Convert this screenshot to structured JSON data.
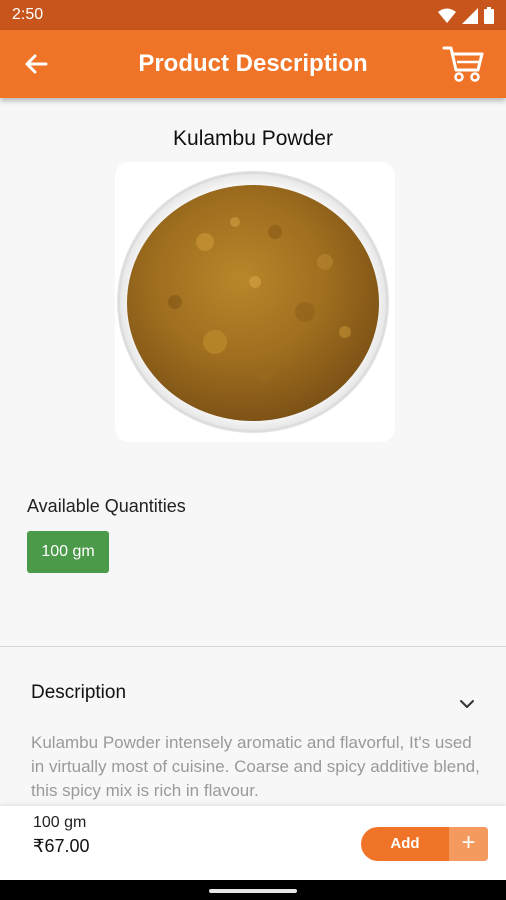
{
  "status_bar": {
    "time": "2:50"
  },
  "app_bar": {
    "title": "Product Description",
    "back_icon": "arrow-left-icon",
    "cart_icon": "shopping-cart-icon"
  },
  "product": {
    "name": "Kulambu Powder",
    "image_icon": "spice-powder-bowl-image"
  },
  "quantities": {
    "label": "Available Quantities",
    "options": [
      "100 gm"
    ],
    "selected": "100 gm"
  },
  "description": {
    "title": "Description",
    "text": "Kulambu Powder intensely aromatic and flavorful, It's used in virtually most of cuisine. Coarse and spicy additive blend, this spicy mix is rich in flavour."
  },
  "bottom_bar": {
    "quantity": "100 gm",
    "price": "₹67.00",
    "add_label": "Add",
    "plus_label": "+"
  },
  "colors": {
    "primary": "#f07427",
    "status_bar": "#c8561c",
    "chip": "#4a9a4a"
  }
}
